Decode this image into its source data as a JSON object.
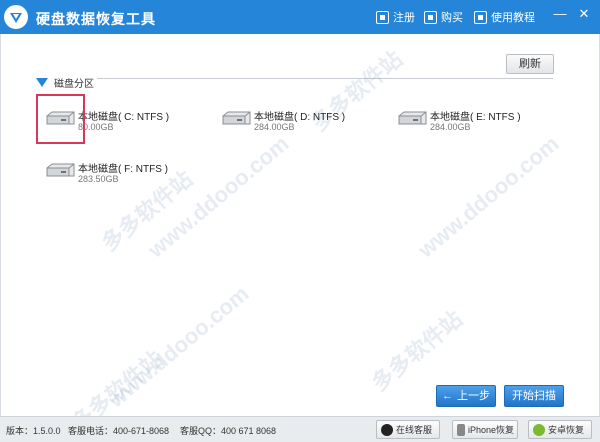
{
  "titlebar": {
    "title": "硬盘数据恢复工具",
    "register_label": "注册",
    "buy_label": "购买",
    "tutorial_label": "使用教程",
    "minimize_symbol": "—",
    "close_symbol": "✕"
  },
  "toolbar": {
    "refresh_label": "刷新"
  },
  "section": {
    "label": "磁盘分区"
  },
  "drives": [
    {
      "name": "本地磁盘( C: NTFS )",
      "size": "80.00GB",
      "icon": "hard-drive-icon"
    },
    {
      "name": "本地磁盘( D: NTFS )",
      "size": "284.00GB",
      "icon": "hard-drive-icon"
    },
    {
      "name": "本地磁盘( E: NTFS )",
      "size": "284.00GB",
      "icon": "hard-drive-icon"
    },
    {
      "name": "本地磁盘( F: NTFS )",
      "size": "283.50GB",
      "icon": "hard-drive-icon"
    }
  ],
  "watermark": {
    "site": "www.ddooo.com",
    "cn": "多多软件站"
  },
  "nav": {
    "back_label": "上一步",
    "scan_label": "开始扫描"
  },
  "status": {
    "version": "版本：1.5.0.0",
    "phone": "客服电话：400-671-8068",
    "qq": "客服QQ：400 671 8068",
    "online_service_label": "在线客服",
    "iphone_recovery_label": "iPhone恢复",
    "android_recovery_label": "安卓恢复"
  },
  "colors": {
    "accent": "#2585d8",
    "selection": "#d9365b"
  }
}
